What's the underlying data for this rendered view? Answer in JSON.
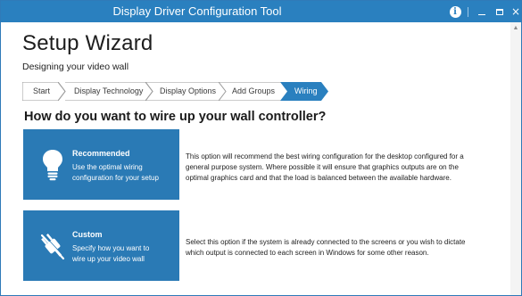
{
  "window": {
    "title": "Display Driver Configuration Tool",
    "controls": {
      "info": "i",
      "close": "×"
    },
    "scroll_up": "▲"
  },
  "wizard": {
    "title": "Setup Wizard",
    "subtitle": "Designing your video wall",
    "steps": [
      {
        "label": "Start",
        "active": false
      },
      {
        "label": "Display Technology",
        "active": false
      },
      {
        "label": "Display Options",
        "active": false
      },
      {
        "label": "Add Groups",
        "active": false
      },
      {
        "label": "Wiring",
        "active": true
      }
    ],
    "question": "How do you want to wire up your wall controller?"
  },
  "options": [
    {
      "title": "Recommended",
      "desc": "Use the optimal wiring\nconfiguration for your setup",
      "icon": "lightbulb-icon",
      "text": "This option will recommend the best wiring configuration for the desktop configured for a\ngeneral purpose system. Where possible it will ensure that graphics outputs are on the\noptimal graphics card and that the load is balanced between the available hardware."
    },
    {
      "title": "Custom",
      "desc": "Specify how you want to\nwire up your video wall",
      "icon": "plug-icon",
      "text": "Select this option if the system is already connected to the screens or you wish to dictate\nwhich output is connected to each screen in Windows for some other reason."
    }
  ],
  "colors": {
    "titlebar": "#2a80bf",
    "card": "#2a7ab5",
    "active_step": "#2a80bf"
  }
}
